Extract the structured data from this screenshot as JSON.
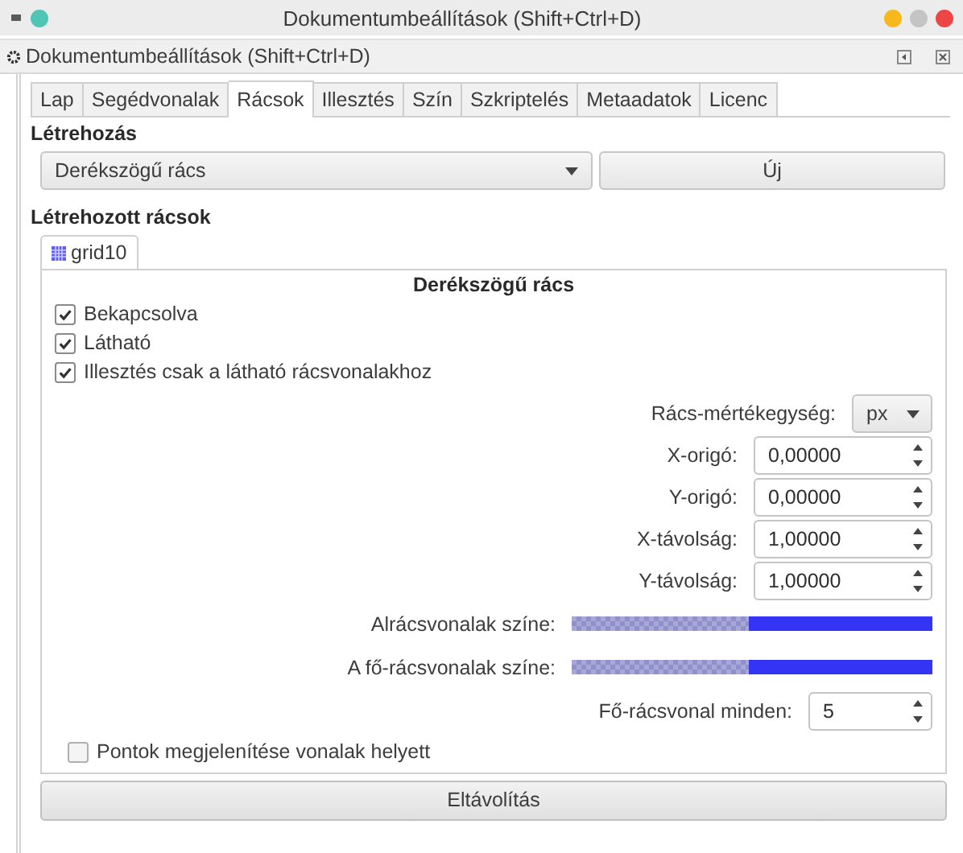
{
  "window": {
    "title": "Dokumentumbeállítások (Shift+Ctrl+D)"
  },
  "panel": {
    "title": "Dokumentumbeállítások (Shift+Ctrl+D)"
  },
  "tabs": [
    {
      "label": "Lap",
      "selected": false
    },
    {
      "label": "Segédvonalak",
      "selected": false
    },
    {
      "label": "Rácsok",
      "selected": true
    },
    {
      "label": "Illesztés",
      "selected": false
    },
    {
      "label": "Szín",
      "selected": false
    },
    {
      "label": "Szkriptelés",
      "selected": false
    },
    {
      "label": "Metaadatok",
      "selected": false
    },
    {
      "label": "Licenc",
      "selected": false
    }
  ],
  "creation": {
    "heading": "Létrehozás",
    "grid_type": "Derékszögű rács",
    "new_button": "Új"
  },
  "created": {
    "heading": "Létrehozott rácsok",
    "grid_tabs": [
      {
        "label": "grid10",
        "selected": true
      }
    ]
  },
  "grid": {
    "title": "Derékszögű rács",
    "options": [
      {
        "label": "Bekapcsolva",
        "checked": true
      },
      {
        "label": "Látható",
        "checked": true
      },
      {
        "label": "Illesztés csak a látható rácsvonalakhoz",
        "checked": true
      }
    ],
    "unit": {
      "label": "Rács-mértékegység:",
      "value": "px"
    },
    "fields": [
      {
        "label": "X-origó:",
        "value": "0,00000"
      },
      {
        "label": "Y-origó:",
        "value": "0,00000"
      },
      {
        "label": "X-távolság:",
        "value": "1,00000"
      },
      {
        "label": "Y-távolság:",
        "value": "1,00000"
      }
    ],
    "colors": [
      {
        "label": "Alrácsvonalak színe:",
        "color": "#3434f5"
      },
      {
        "label": "A fő-rácsvonalak színe:",
        "color": "#3434f5"
      }
    ],
    "major_every": {
      "label": "Fő-rácsvonal minden:",
      "value": "5"
    },
    "dots_option": {
      "label": "Pontok megjelenítése vonalak helyett",
      "checked": false
    }
  },
  "remove_button": "Eltávolítás"
}
